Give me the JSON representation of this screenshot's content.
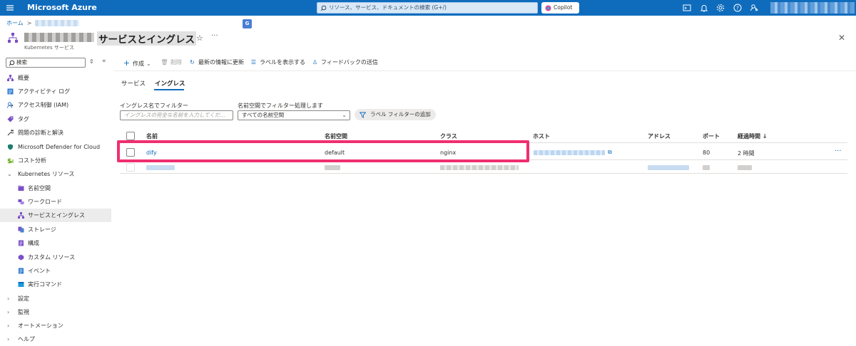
{
  "topbar": {
    "brand": "Microsoft Azure",
    "search_placeholder": "リソース、サービス、ドキュメントの検索 (G+/)",
    "copilot_label": "Copilot",
    "icons": [
      "cloud-shell-icon",
      "bell-icon",
      "gear-icon",
      "help-icon",
      "feedback-icon"
    ],
    "accent": "#0f6cbd"
  },
  "breadcrumb": {
    "home": "ホーム"
  },
  "header": {
    "title": "サービスとイングレス",
    "subtitle": "Kubernetes サービス"
  },
  "sidebar": {
    "search_placeholder": "検索",
    "items": [
      {
        "label": "概要",
        "icon": "overview-icon"
      },
      {
        "label": "アクティビティ ログ",
        "icon": "activity-log-icon"
      },
      {
        "label": "アクセス制御 (IAM)",
        "icon": "iam-icon"
      },
      {
        "label": "タグ",
        "icon": "tag-icon"
      },
      {
        "label": "問題の診断と解決",
        "icon": "wrench-icon"
      },
      {
        "label": "Microsoft Defender for Cloud",
        "icon": "shield-icon"
      },
      {
        "label": "コスト分析",
        "icon": "cost-icon"
      },
      {
        "label": "Kubernetes リソース",
        "expanded": true
      },
      {
        "label": "名前空間",
        "icon": "namespace-icon"
      },
      {
        "label": "ワークロード",
        "icon": "workload-icon"
      },
      {
        "label": "サービスとイングレス",
        "icon": "services-icon",
        "active": true
      },
      {
        "label": "ストレージ",
        "icon": "storage-icon"
      },
      {
        "label": "構成",
        "icon": "config-icon"
      },
      {
        "label": "カスタム リソース",
        "icon": "custom-resource-icon"
      },
      {
        "label": "イベント",
        "icon": "event-icon"
      },
      {
        "label": "実行コマンド",
        "icon": "run-command-icon"
      },
      {
        "label": "設定",
        "expanded": false
      },
      {
        "label": "監視",
        "expanded": false
      },
      {
        "label": "オートメーション",
        "expanded": false
      },
      {
        "label": "ヘルプ",
        "expanded": false
      }
    ]
  },
  "toolbar": {
    "create": "作成",
    "delete": "削除",
    "refresh": "最新の情報に更新",
    "show_labels": "ラベルを表示する",
    "feedback": "フィードバックの送信"
  },
  "tabs": {
    "services": "サービス",
    "ingress": "イングレス"
  },
  "filters": {
    "name_label": "イングレス名でフィルター",
    "name_placeholder": "イングレスの完全な名前を入力してくだ...",
    "namespace_label": "名前空間でフィルター処理します",
    "namespace_value": "すべての名前空間",
    "label_filter": "ラベル フィルターの追加"
  },
  "table": {
    "columns": [
      "名前",
      "名前空間",
      "クラス",
      "ホスト",
      "アドレス",
      "ポート",
      "経過時間 ↓"
    ],
    "rows": [
      {
        "name": "dify",
        "namespace": "default",
        "class": "nginx",
        "host": "",
        "address": "",
        "port": "80",
        "age": "2 時間"
      }
    ],
    "highlight_color": "#ef2f6f"
  }
}
